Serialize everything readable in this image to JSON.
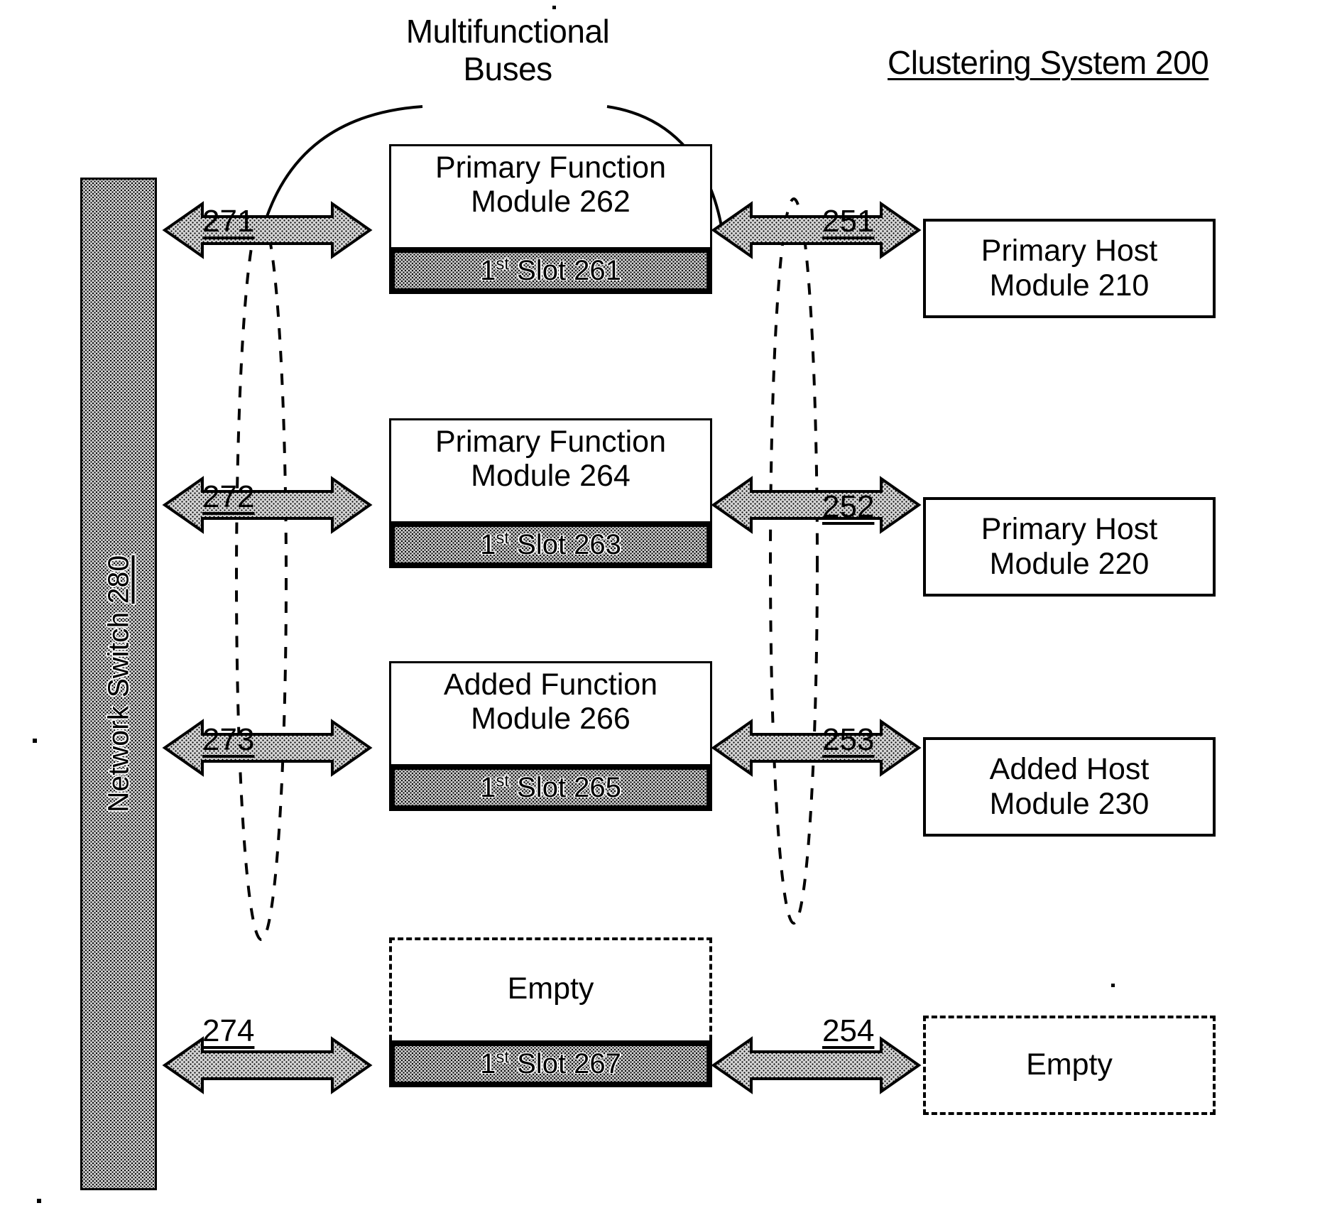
{
  "figure": {
    "title_right": "Clustering System 200",
    "title_center": "Multifunctional\nBuses"
  },
  "network_switch": {
    "label": "Network Switch ",
    "ref": "280"
  },
  "rows": [
    {
      "bus_ref": "271",
      "function_module": {
        "title": "Primary Function\nModule 262",
        "dashed": false,
        "slot_prefix": "1",
        "slot_sup": "st",
        "slot_suffix": " Slot 261"
      },
      "host_ref": "251",
      "host_module": {
        "title": "Primary Host\nModule 210",
        "dashed": false
      }
    },
    {
      "bus_ref": "272",
      "function_module": {
        "title": "Primary Function\nModule 264",
        "dashed": false,
        "slot_prefix": "1",
        "slot_sup": "st",
        "slot_suffix": " Slot 263"
      },
      "host_ref": "252",
      "host_module": {
        "title": "Primary Host\nModule 220",
        "dashed": false
      }
    },
    {
      "bus_ref": "273",
      "function_module": {
        "title": "Added Function\nModule 266",
        "dashed": false,
        "slot_prefix": "1",
        "slot_sup": "st",
        "slot_suffix": " Slot 265"
      },
      "host_ref": "253",
      "host_module": {
        "title": "Added Host\nModule 230",
        "dashed": false
      }
    },
    {
      "bus_ref": "274",
      "function_module": {
        "title": "Empty",
        "dashed": true,
        "slot_prefix": "1",
        "slot_sup": "st",
        "slot_suffix": " Slot 267"
      },
      "host_ref": "254",
      "host_module": {
        "title": "Empty",
        "dashed": true
      }
    }
  ],
  "colors": {
    "ink": "#000000",
    "paper": "#ffffff",
    "stipple_fill": "#c8c8c8"
  }
}
